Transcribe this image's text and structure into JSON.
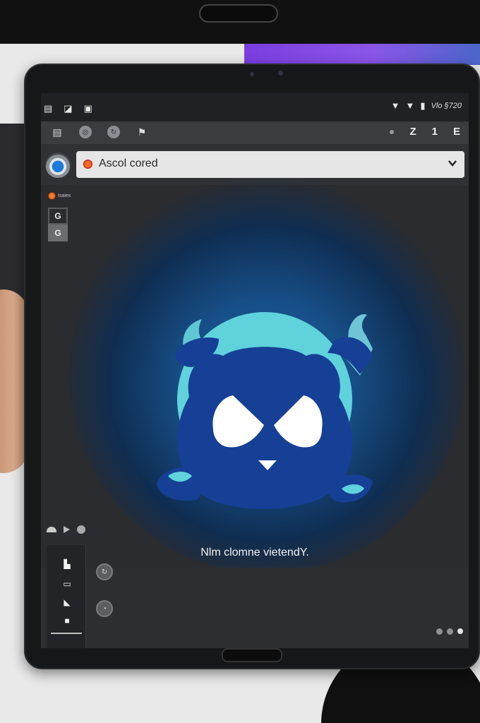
{
  "address_bar": {
    "text": "Ascol cored"
  },
  "side_panel": {
    "tag_label": "tsaies",
    "button_one": "G",
    "button_two": "G"
  },
  "statusbar": {
    "right_text": "Vlo §720",
    "signal_1": "▼",
    "signal_2": "▼"
  },
  "toolbar": {
    "right_items": [
      "Ζ",
      "1",
      "E"
    ]
  },
  "hero": {
    "caption": "Nlm clomne vietendY."
  },
  "colors": {
    "screen_bg": "#2a2c30",
    "hero_blue": "#163f96",
    "hero_cyan": "#5fd2dc",
    "glow": "#1b5fa0"
  }
}
